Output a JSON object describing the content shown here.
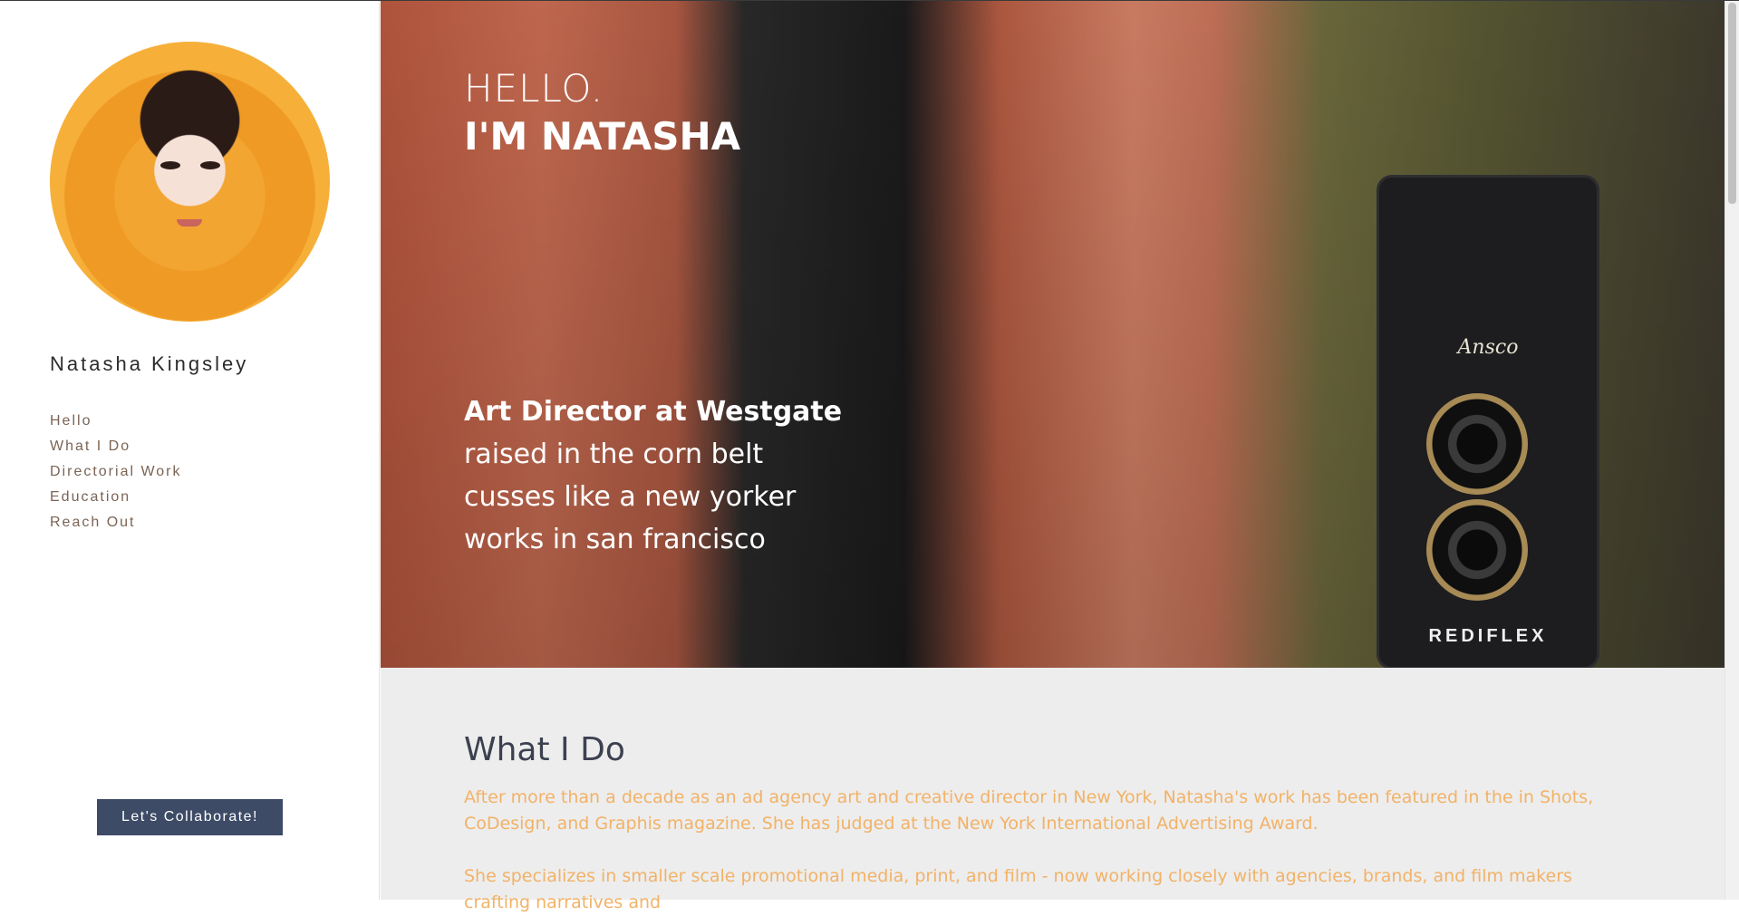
{
  "sidebar": {
    "name": "Natasha Kingsley",
    "nav": [
      "Hello",
      "What I Do",
      "Directorial Work",
      "Education",
      "Reach Out"
    ],
    "cta_label": "Let's Collaborate!"
  },
  "hero": {
    "greeting": "HELLO.",
    "headline": "I'M NATASHA",
    "role": "Art Director at Westgate",
    "lines": [
      "raised in the corn belt",
      "cusses like a new yorker",
      "works in san francisco"
    ],
    "camera_brand_top": "Ansco",
    "camera_brand_bottom": "REDIFLEX"
  },
  "about": {
    "title": "What I Do",
    "p1": "After more than a decade as an ad agency art and creative director in New York, Natasha's work has been featured in the in Shots, CoDesign, and Graphis magazine. She has judged at the New York International Advertising Award.",
    "p2": "She specializes in smaller scale promotional media, print, and film - now working closely with agencies, brands, and film makers crafting narratives and"
  },
  "colors": {
    "accent": "#3d4b66",
    "body_text": "#f2b267",
    "heading": "#3c4150",
    "nav_text": "#7a6455"
  }
}
